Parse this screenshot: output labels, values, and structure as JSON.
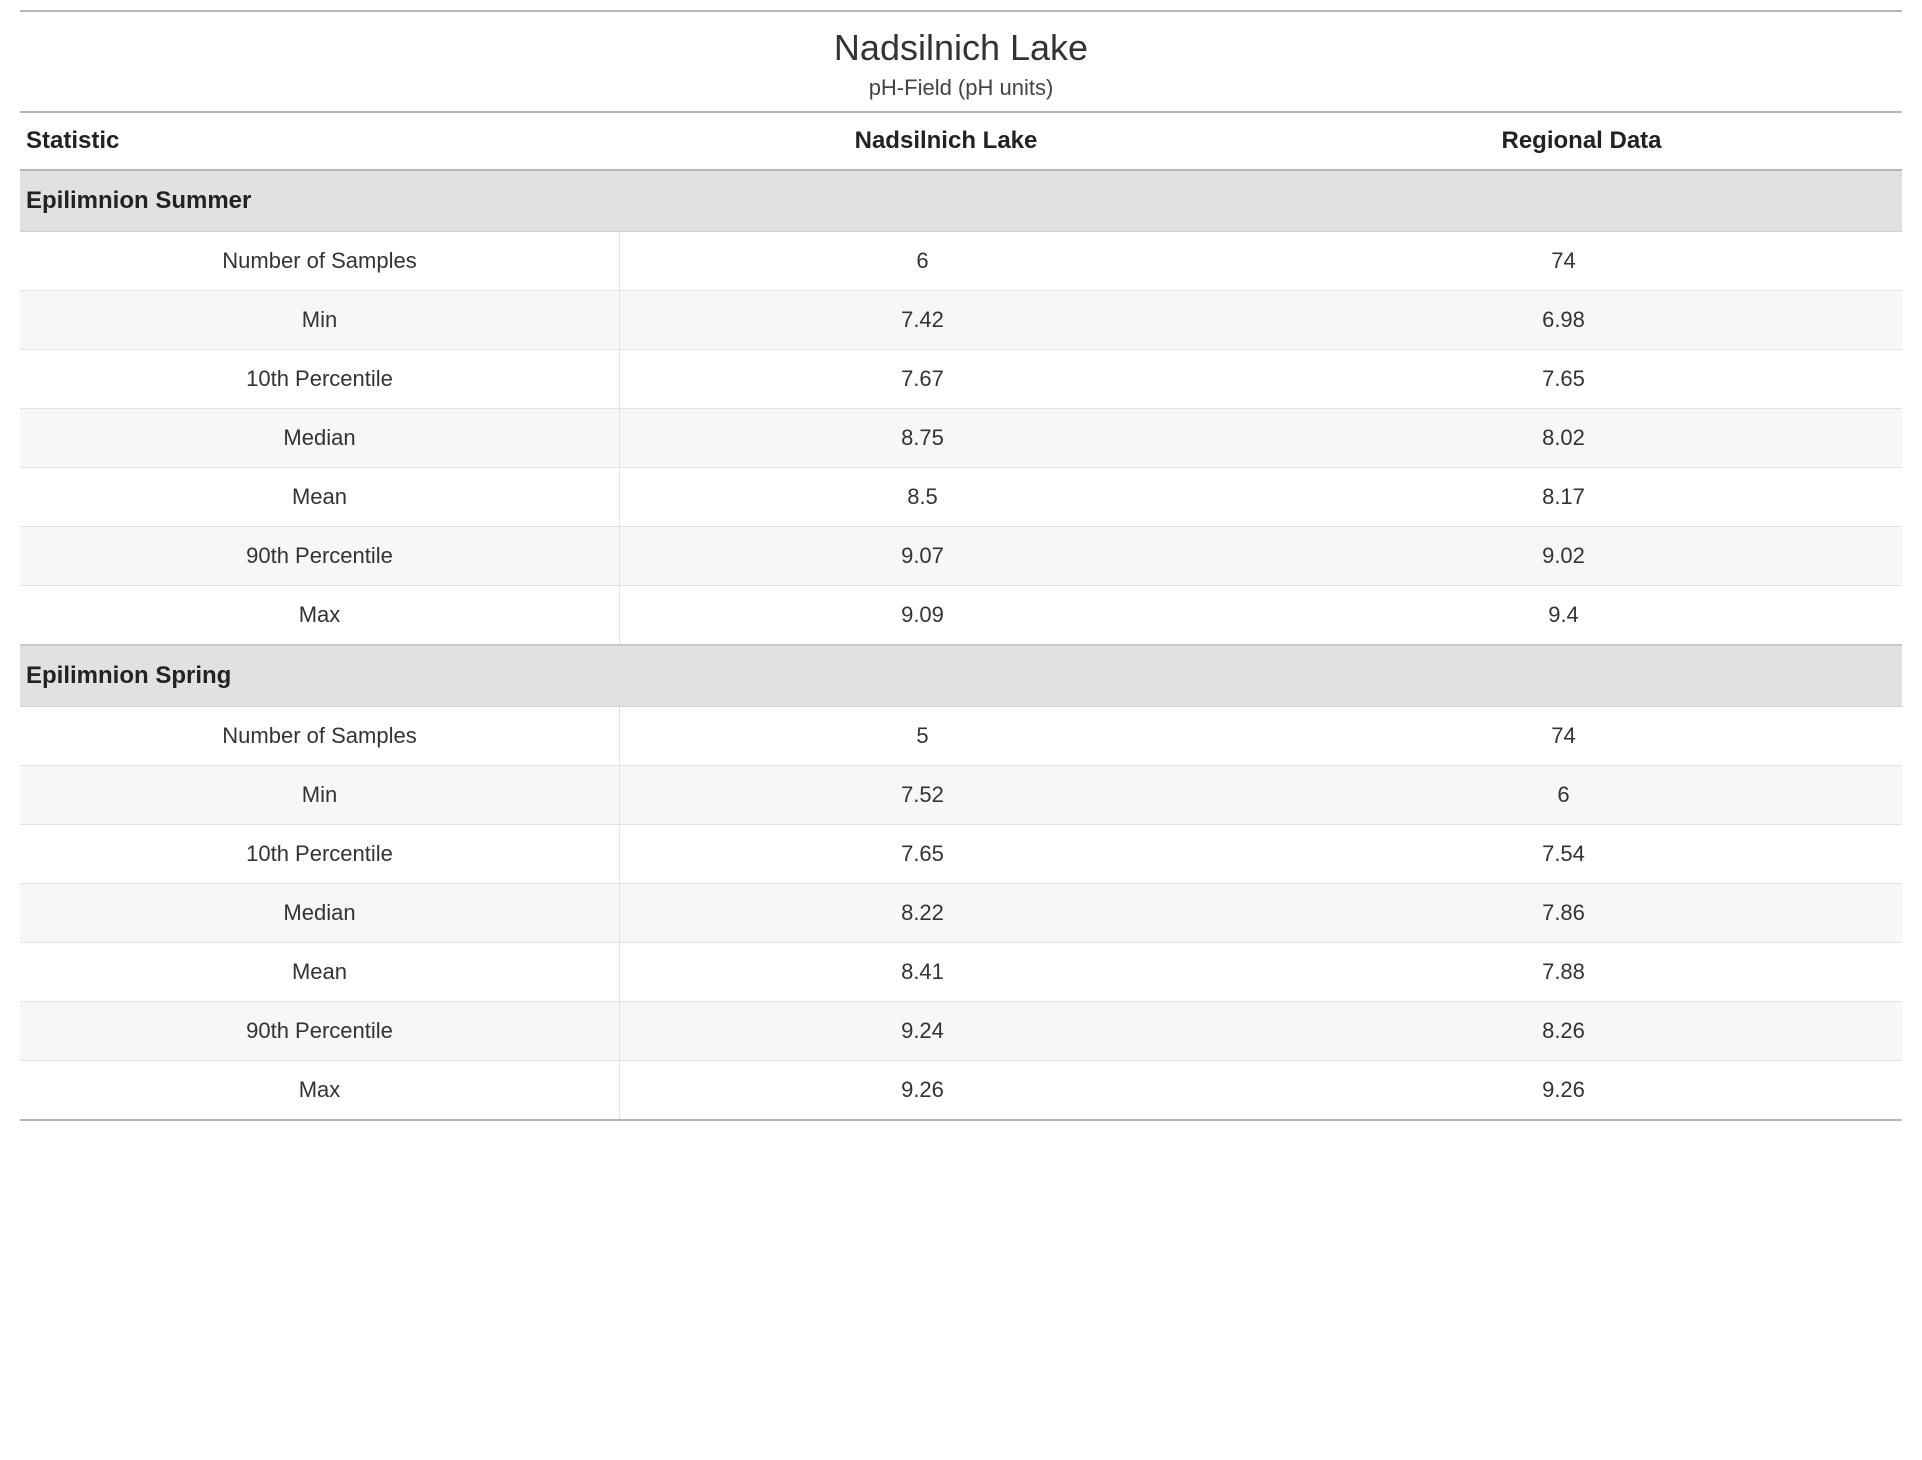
{
  "title": "Nadsilnich Lake",
  "subtitle": "pH-Field (pH units)",
  "columns": {
    "statistic": "Statistic",
    "lake": "Nadsilnich Lake",
    "regional": "Regional Data"
  },
  "sections": [
    {
      "name": "Epilimnion Summer",
      "rows": [
        {
          "statistic": "Number of Samples",
          "lake": "6",
          "regional": "74"
        },
        {
          "statistic": "Min",
          "lake": "7.42",
          "regional": "6.98"
        },
        {
          "statistic": "10th Percentile",
          "lake": "7.67",
          "regional": "7.65"
        },
        {
          "statistic": "Median",
          "lake": "8.75",
          "regional": "8.02"
        },
        {
          "statistic": "Mean",
          "lake": "8.5",
          "regional": "8.17"
        },
        {
          "statistic": "90th Percentile",
          "lake": "9.07",
          "regional": "9.02"
        },
        {
          "statistic": "Max",
          "lake": "9.09",
          "regional": "9.4"
        }
      ]
    },
    {
      "name": "Epilimnion Spring",
      "rows": [
        {
          "statistic": "Number of Samples",
          "lake": "5",
          "regional": "74"
        },
        {
          "statistic": "Min",
          "lake": "7.52",
          "regional": "6"
        },
        {
          "statistic": "10th Percentile",
          "lake": "7.65",
          "regional": "7.54"
        },
        {
          "statistic": "Median",
          "lake": "8.22",
          "regional": "7.86"
        },
        {
          "statistic": "Mean",
          "lake": "8.41",
          "regional": "7.88"
        },
        {
          "statistic": "90th Percentile",
          "lake": "9.24",
          "regional": "8.26"
        },
        {
          "statistic": "Max",
          "lake": "9.26",
          "regional": "9.26"
        }
      ]
    }
  ]
}
